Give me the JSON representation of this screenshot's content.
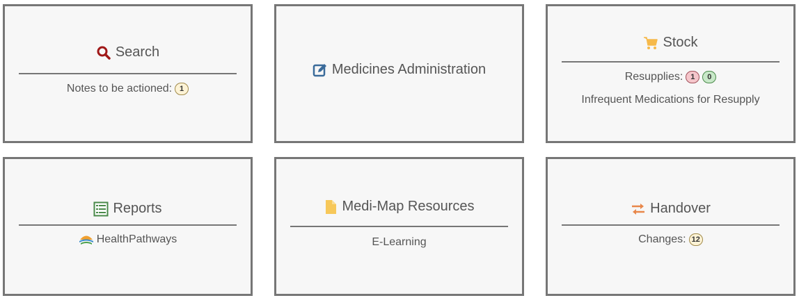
{
  "tiles": {
    "search": {
      "title": "Search",
      "icon": "search-icon",
      "notes_label": "Notes to be actioned:",
      "notes_count": "1"
    },
    "medicines": {
      "title": "Medicines Administration",
      "icon": "edit-icon"
    },
    "stock": {
      "title": "Stock",
      "icon": "cart-icon",
      "resupplies_label": "Resupplies:",
      "resupplies_red": "1",
      "resupplies_green": "0",
      "infrequent_label": "Infrequent Medications for Resupply"
    },
    "reports": {
      "title": "Reports",
      "icon": "list-icon",
      "link_label": "HealthPathways",
      "link_icon": "healthpathways-logo-icon"
    },
    "resources": {
      "title": "Medi-Map Resources",
      "icon": "file-icon",
      "link_label": "E-Learning"
    },
    "handover": {
      "title": "Handover",
      "icon": "exchange-icon",
      "changes_label": "Changes:",
      "changes_count": "12"
    }
  },
  "colors": {
    "search_icon": "#a01818",
    "edit_icon": "#3a6b9a",
    "cart_icon": "#f6b94a",
    "list_icon": "#4a8a4a",
    "file_icon": "#f7c85a",
    "exchange_icon": "#e8874a"
  }
}
